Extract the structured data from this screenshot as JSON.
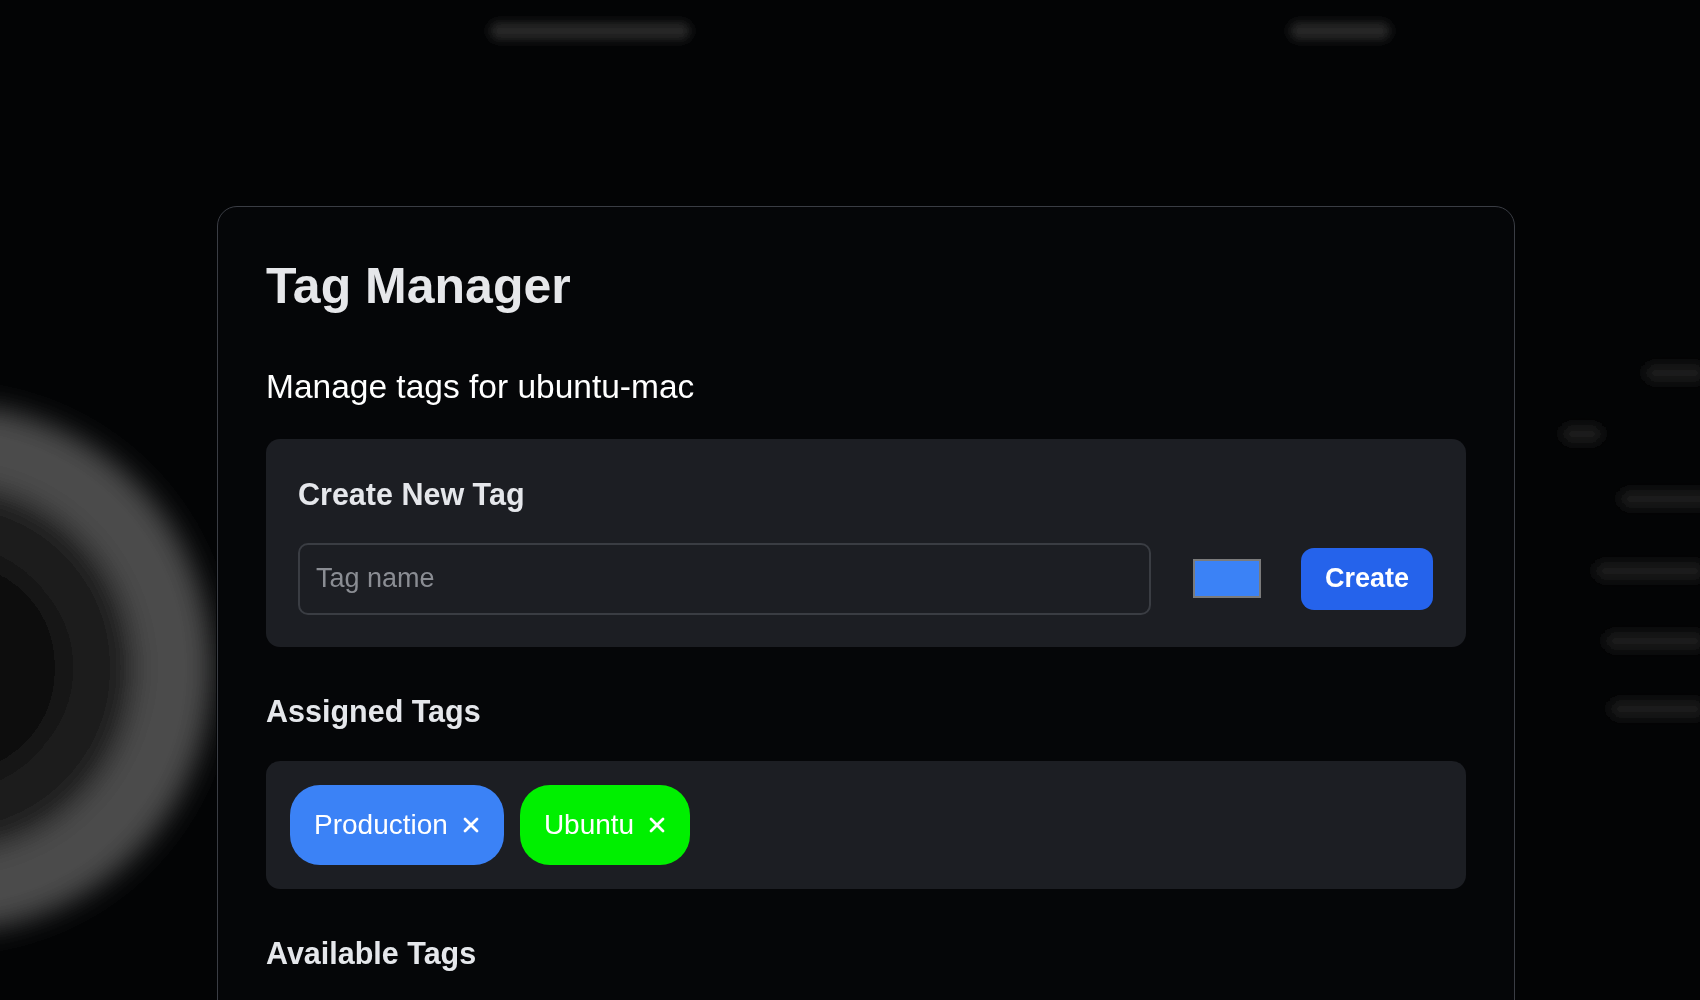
{
  "dialog": {
    "title": "Tag Manager",
    "subtitle": "Manage tags for ubuntu-mac"
  },
  "create_tag": {
    "title": "Create New Tag",
    "name_field": {
      "placeholder": "Tag name"
    },
    "color_field": {
      "color": "#3b82f6"
    },
    "button": "Create"
  },
  "assigned_tags": {
    "title": "Assigned Tags",
    "tags": [
      {
        "label": "Production",
        "color": "#3b82f6"
      },
      {
        "label": "Ubuntu",
        "color": "#00f000"
      }
    ]
  },
  "available_tags": {
    "title": "Available Tags"
  }
}
